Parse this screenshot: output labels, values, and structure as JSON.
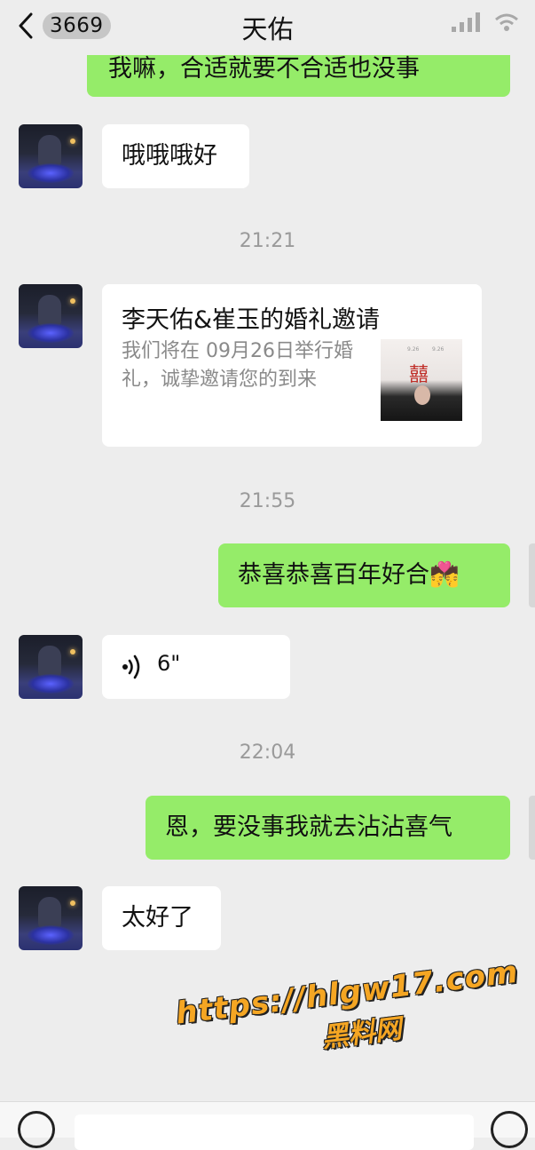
{
  "header": {
    "unread_count": "3669",
    "title": "天佑"
  },
  "messages": {
    "m0_text": "我嘛，合适就要不合适也没事",
    "m1_text": "哦哦哦好",
    "ts1": "21:21",
    "card": {
      "title": "李天佑&崔玉的婚礼邀请",
      "desc": "我们将在 09月26日举行婚礼，诚挚邀请您的到来",
      "thumb_char": "囍"
    },
    "ts2": "21:55",
    "m3_text": "恭喜恭喜百年好合💏",
    "voice_duration": "6\"",
    "ts3": "22:04",
    "m5_text": "恩，要没事我就去沾沾喜气",
    "m6_text": "太好了"
  },
  "watermark": {
    "url": "https://hlgw17.com",
    "name": "黑料网"
  },
  "colors": {
    "background": "#ededed",
    "incoming_bubble": "#ffffff",
    "outgoing_bubble": "#95ec69",
    "timestamp": "#9a9a9a",
    "watermark": "#f5a623"
  }
}
